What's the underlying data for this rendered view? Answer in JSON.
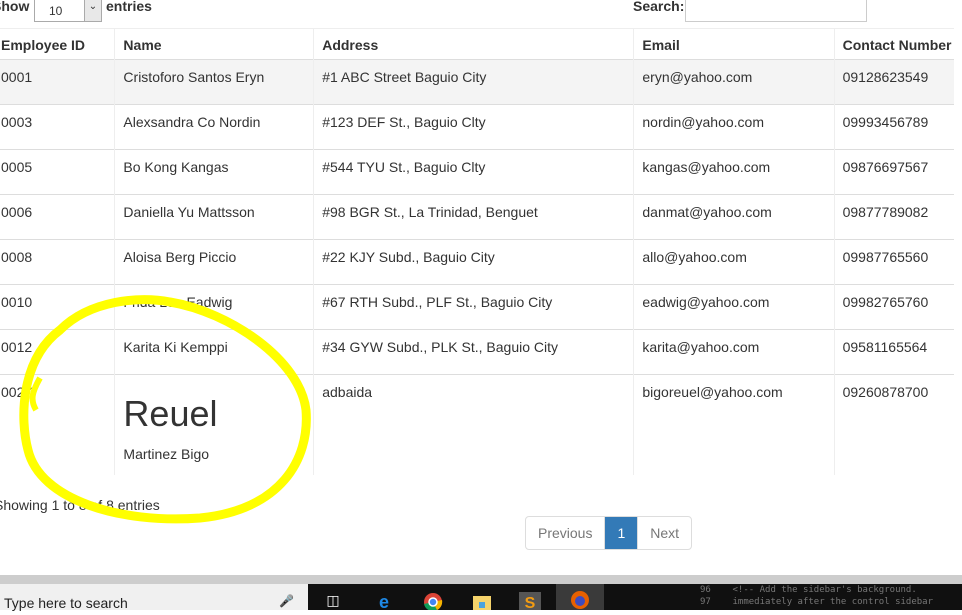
{
  "controls": {
    "show": "Show",
    "length": "10",
    "entries": "entries",
    "search_label": "Search:",
    "search_value": ""
  },
  "columns": [
    "Employee ID",
    "Name",
    "Address",
    "Email",
    "Contact Number"
  ],
  "rows": [
    [
      "0001",
      "Cristoforo Santos Eryn",
      "#1 ABC Street Baguio City",
      "eryn@yahoo.com",
      "09128623549"
    ],
    [
      "0003",
      "Alexsandra Co Nordin",
      "#123 DEF St., Baguio Clty",
      "nordin@yahoo.com",
      "09993456789"
    ],
    [
      "0005",
      "Bo Kong Kangas",
      "#544 TYU St., Baguio Clty",
      "kangas@yahoo.com",
      "09876697567"
    ],
    [
      "0006",
      "Daniella Yu Mattsson",
      "#98 BGR St., La Trinidad, Benguet",
      "danmat@yahoo.com",
      "09877789082"
    ],
    [
      "0008",
      "Aloisa Berg Piccio",
      "#22 KJY Subd., Baguio City",
      "allo@yahoo.com",
      "09987765560"
    ],
    [
      "0010",
      "Frida Lee Eadwig",
      "#67 RTH Subd., PLF St., Baguio City",
      "eadwig@yahoo.com",
      "09982765760"
    ],
    [
      "0012",
      "Karita Ki Kemppi",
      "#34 GYW Subd., PLK St., Baguio City",
      "karita@yahoo.com",
      "09581165564"
    ]
  ],
  "last_row": {
    "id": "0027",
    "name_big": "Reuel",
    "name_small": "Martinez Bigo",
    "address": "adbaida",
    "email": "bigoreuel@yahoo.com",
    "contact": "09260878700"
  },
  "info": "Showing 1 to 8 of 8 entries",
  "pagination": {
    "previous": "Previous",
    "page": "1",
    "next": "Next"
  },
  "taskbar": {
    "search_placeholder": "Type here to search",
    "code_lines": [
      "96    <!-- Add the sidebar's background.",
      "97    immediately after the control sidebar"
    ]
  },
  "highlight_color": "#ffff00"
}
